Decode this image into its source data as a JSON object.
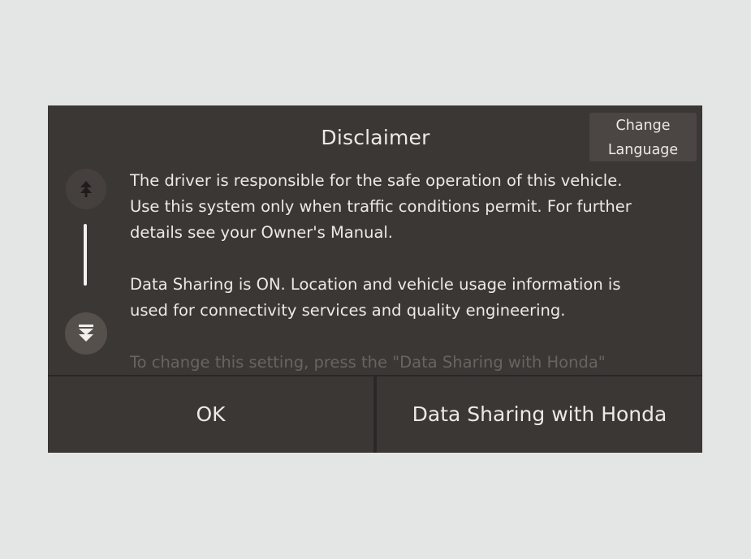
{
  "dialog": {
    "title": "Disclaimer",
    "change_language_line1": "Change",
    "change_language_line2": "Language",
    "paragraphs": [
      {
        "lines": [
          "The driver is responsible for the safe operation of this vehicle.",
          "Use this system only when traffic conditions permit. For further",
          "details see your Owner's Manual."
        ]
      },
      {
        "lines": [
          "Data Sharing is ON. Location and vehicle usage information is",
          "used for connectivity services and quality engineering."
        ]
      },
      {
        "lines": [
          "To change this setting, press the \"Data Sharing with Honda\""
        ]
      }
    ],
    "ok_label": "OK",
    "data_sharing_label": "Data Sharing with Honda"
  },
  "icons": {
    "scroll_up": "double-chevron-up-icon",
    "scroll_down": "double-chevron-down-icon"
  },
  "colors": {
    "background": "#e4e6e5",
    "dialog": "#3b3735",
    "text": "#ece9e6",
    "divider": "#2a2726"
  }
}
